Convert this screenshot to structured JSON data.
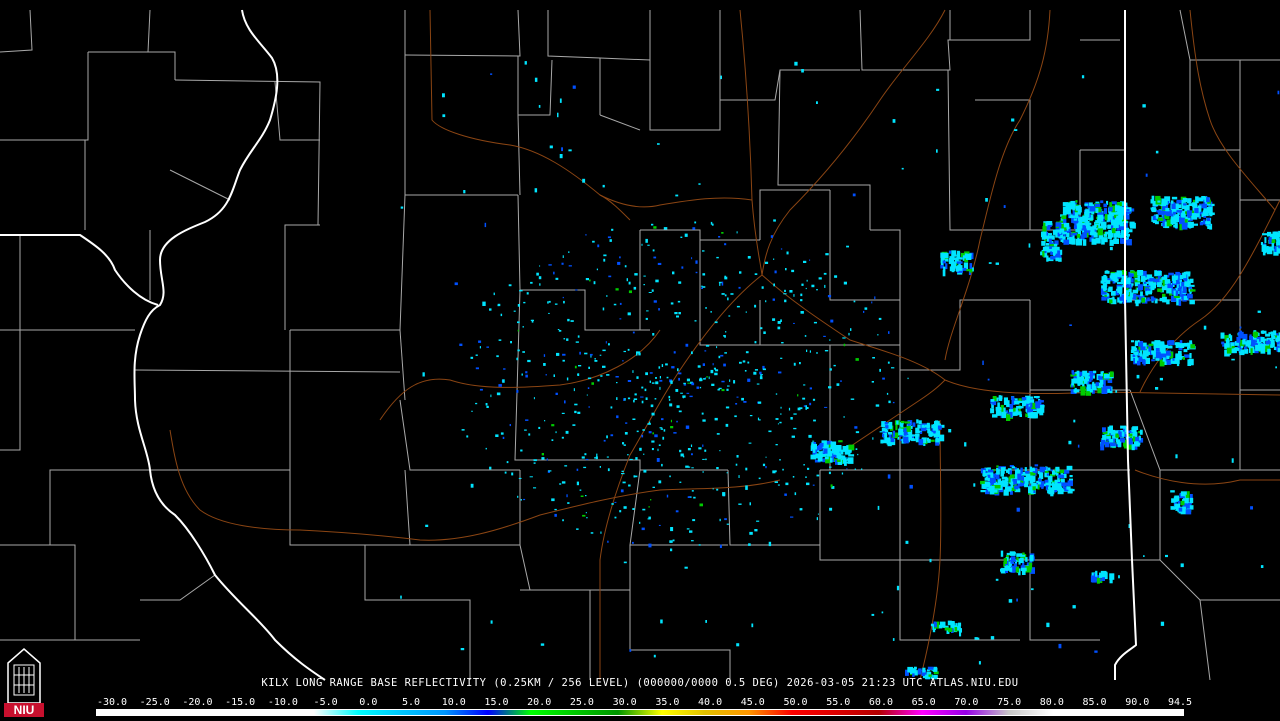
{
  "caption": "KILX LONG RANGE BASE REFLECTIVITY (0.25KM / 256 LEVEL) (000000/0000 0.5 DEG) 2026-03-05 21:23 UTC  ATLAS.NIU.EDU",
  "logo": {
    "text": "NIU",
    "icon": "university-tower-icon"
  },
  "colorbar": {
    "ticks": [
      "-30.0",
      "-25.0",
      "-20.0",
      "-15.0",
      "-10.0",
      "-5.0",
      "0.0",
      "5.0",
      "10.0",
      "15.0",
      "20.0",
      "25.0",
      "30.0",
      "35.0",
      "40.0",
      "45.0",
      "50.0",
      "55.0",
      "60.0",
      "65.0",
      "70.0",
      "75.0",
      "80.0",
      "85.0",
      "90.0",
      "94.5"
    ],
    "colors": [
      "#ffffff",
      "#ffffff",
      "#ffffff",
      "#ffffff",
      "#ffffff",
      "#ffffff",
      "#00ffff",
      "#00c8ff",
      "#0096ff",
      "#0000ff",
      "#00ff00",
      "#00c800",
      "#009600",
      "#ffff00",
      "#e1c000",
      "#ff9600",
      "#ff0000",
      "#dc0000",
      "#b40000",
      "#ff00ff",
      "#9600e6",
      "#c8c8c8",
      "#ffffff",
      "#ffffff",
      "#ffffff",
      "#ffffff"
    ]
  },
  "colors": {
    "background": "#000000",
    "county_lines": "#b4b4b4",
    "state_lines": "#ffffff",
    "roads": "#8b4513",
    "echo_light": "#00e5ff",
    "echo_mid": "#0050ff",
    "echo_heavy": "#00cc00"
  }
}
